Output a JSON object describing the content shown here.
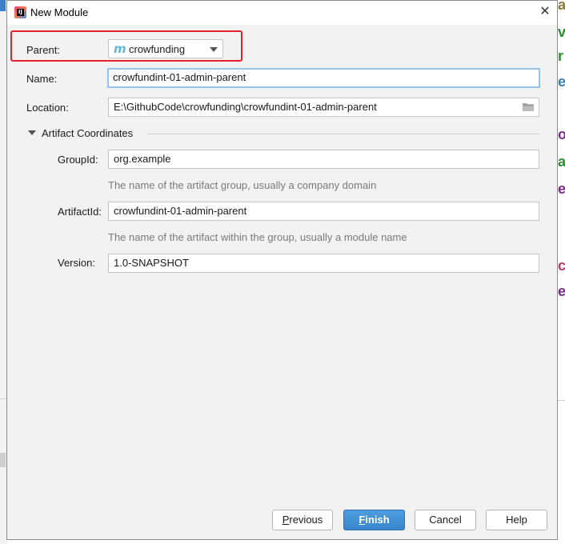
{
  "window": {
    "title": "New Module",
    "close_glyph": "✕"
  },
  "form": {
    "parent": {
      "label": "Parent:",
      "value": "crowfunding",
      "icon": "maven-m-icon",
      "icon_glyph": "m"
    },
    "name": {
      "label": "Name:",
      "value": "crowfundint-01-admin-parent"
    },
    "location": {
      "label": "Location:",
      "value": "E:\\GithubCode\\crowfunding\\crowfundint-01-admin-parent"
    },
    "artifact_section": {
      "title": "Artifact Coordinates"
    },
    "group_id": {
      "label": "GroupId:",
      "value": "org.example",
      "hint": "The name of the artifact group, usually a company domain"
    },
    "artifact_id": {
      "label": "ArtifactId:",
      "value": "crowfundint-01-admin-parent",
      "hint": "The name of the artifact within the group, usually a module name"
    },
    "version": {
      "label": "Version:",
      "value": "1.0-SNAPSHOT"
    }
  },
  "buttons": {
    "previous": {
      "mnemonic": "P",
      "rest": "revious"
    },
    "finish": {
      "mnemonic": "F",
      "rest": "inish"
    },
    "cancel": "Cancel",
    "help": "Help"
  },
  "colors": {
    "highlight_box": "#e6202a",
    "primary_button": "#3a86cc",
    "focus_border": "#93c4f0"
  }
}
